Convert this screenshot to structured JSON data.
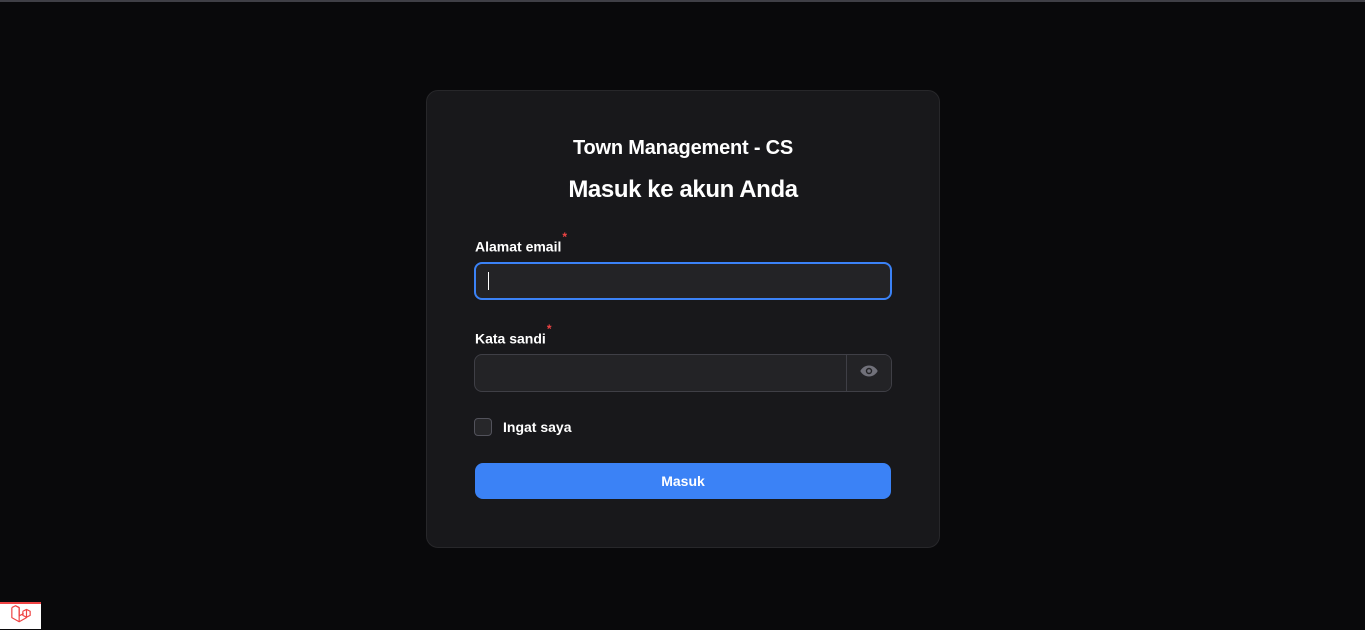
{
  "app": {
    "brand": "Town Management - CS",
    "heading": "Masuk ke akun Anda"
  },
  "form": {
    "email_label": "Alamat email",
    "email_value": "",
    "password_label": "Kata sandi",
    "password_value": "",
    "required_marker": "*",
    "remember_label": "Ingat saya",
    "remember_checked": false,
    "submit_label": "Masuk"
  },
  "icons": {
    "password_toggle": "eye-icon",
    "debugbar": "laravel-logo-icon"
  },
  "colors": {
    "background": "#09090b",
    "card": "#18181b",
    "primary": "#3b82f6",
    "required": "#ef4444"
  }
}
